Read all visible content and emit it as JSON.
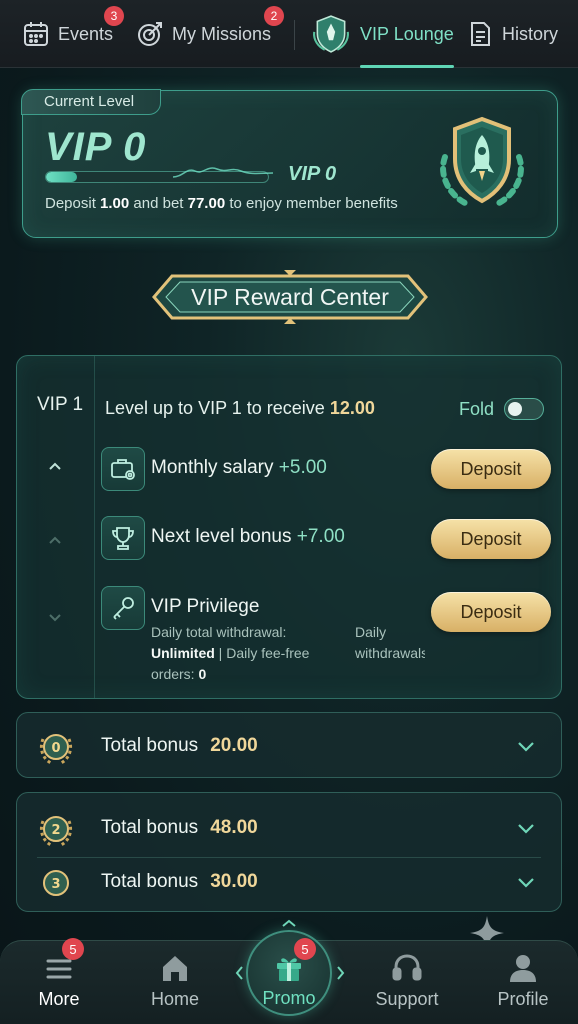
{
  "tabs": [
    {
      "label": "Events",
      "badge": "3",
      "icon": "calendar-icon"
    },
    {
      "label": "My Missions",
      "badge": "2",
      "icon": "target-icon"
    },
    {
      "label": "VIP Lounge",
      "badge": "",
      "icon": "vip-shield-icon",
      "active": true
    },
    {
      "label": "History",
      "badge": "",
      "icon": "document-icon"
    }
  ],
  "level_card": {
    "label": "Current Level",
    "current": "VIP 0",
    "next": "VIP 0",
    "progress_percent": 14,
    "text_prefix": "Deposit",
    "deposit_amount": "1.00",
    "text_middle": "and bet",
    "bet_amount": "77.00",
    "text_suffix": "to enjoy member benefits"
  },
  "banner": {
    "title": "VIP Reward Center"
  },
  "panel": {
    "level": "VIP 1",
    "heading_prefix": "Level up to VIP 1 to receive",
    "heading_amount": "12.00",
    "fold_label": "Fold",
    "rewards": [
      {
        "name": "Monthly salary",
        "amount": "+5.00",
        "button": "Deposit",
        "icon": "briefcase-gear-icon"
      },
      {
        "name": "Next level bonus",
        "amount": "+7.00",
        "button": "Deposit",
        "icon": "trophy-icon"
      },
      {
        "name": "VIP Privilege",
        "amount": "",
        "button": "Deposit",
        "icon": "key-icon"
      }
    ],
    "privilege": {
      "line1": "Daily total withdrawal:",
      "line2_value": "Unlimited",
      "line2_sep": "|",
      "line2_label": "Daily fee-free",
      "line3_label": "orders:",
      "line3_value": "0",
      "col2_line1": "Daily",
      "col2_line2": "withdrawals"
    }
  },
  "groups": [
    {
      "rows": [
        {
          "medal": "VIP 0",
          "label": "Total bonus",
          "amount": "20.00"
        }
      ]
    },
    {
      "rows": [
        {
          "medal": "VIP 2",
          "label": "Total bonus",
          "amount": "48.00"
        },
        {
          "medal": "VIP 3",
          "label": "Total bonus",
          "amount": "30.00"
        }
      ]
    }
  ],
  "bottom_nav": [
    {
      "label": "More",
      "badge": "5",
      "icon": "menu-icon"
    },
    {
      "label": "Home",
      "badge": "",
      "icon": "home-icon"
    },
    {
      "label": "Promo",
      "badge": "5",
      "icon": "gift-icon"
    },
    {
      "label": "Support",
      "badge": "",
      "icon": "headset-icon"
    },
    {
      "label": "Profile",
      "badge": "",
      "icon": "user-icon"
    }
  ],
  "colors": {
    "accent": "#5fd5b5",
    "gold": "#f0d79a",
    "badge": "#e0464f",
    "button": "#e8c77f"
  }
}
